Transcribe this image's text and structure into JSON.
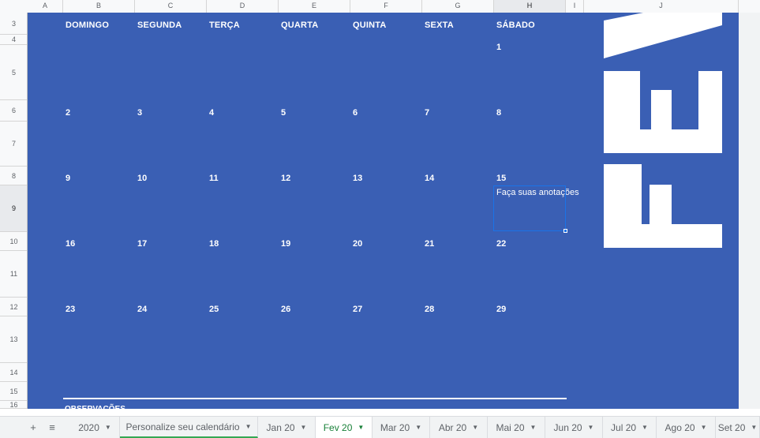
{
  "columns": [
    "A",
    "B",
    "C",
    "D",
    "E",
    "F",
    "G",
    "H",
    "I",
    "J"
  ],
  "rows": [
    "3",
    "4",
    "5",
    "6",
    "7",
    "8",
    "9",
    "10",
    "11",
    "12",
    "13",
    "14",
    "15",
    "16"
  ],
  "calendar": {
    "day_names": [
      "DOMINGO",
      "SEGUNDA",
      "TERÇA",
      "QUARTA",
      "QUINTA",
      "SEXTA",
      "SÁBADO"
    ],
    "weeks": [
      [
        "",
        "",
        "",
        "",
        "",
        "",
        "1"
      ],
      [
        "2",
        "3",
        "4",
        "5",
        "6",
        "7",
        "8"
      ],
      [
        "9",
        "10",
        "11",
        "12",
        "13",
        "14",
        "15"
      ],
      [
        "16",
        "17",
        "18",
        "19",
        "20",
        "21",
        "22"
      ],
      [
        "23",
        "24",
        "25",
        "26",
        "27",
        "28",
        "29"
      ]
    ],
    "note": "Faça suas anotações",
    "month_title": "FEV",
    "observations_label": "OBSERVAÇÕES"
  },
  "sheet_tabs": [
    "2020",
    "Personalize seu calendário",
    "Jan 20",
    "Fev 20",
    "Mar 20",
    "Abr 20",
    "Mai 20",
    "Jun 20",
    "Jul 20",
    "Ago 20",
    "Set 20"
  ],
  "active_tab": "Fev 20",
  "colors": {
    "background": "#3a5fb4",
    "accent_green": "#188038",
    "selection": "#1a73e8"
  }
}
